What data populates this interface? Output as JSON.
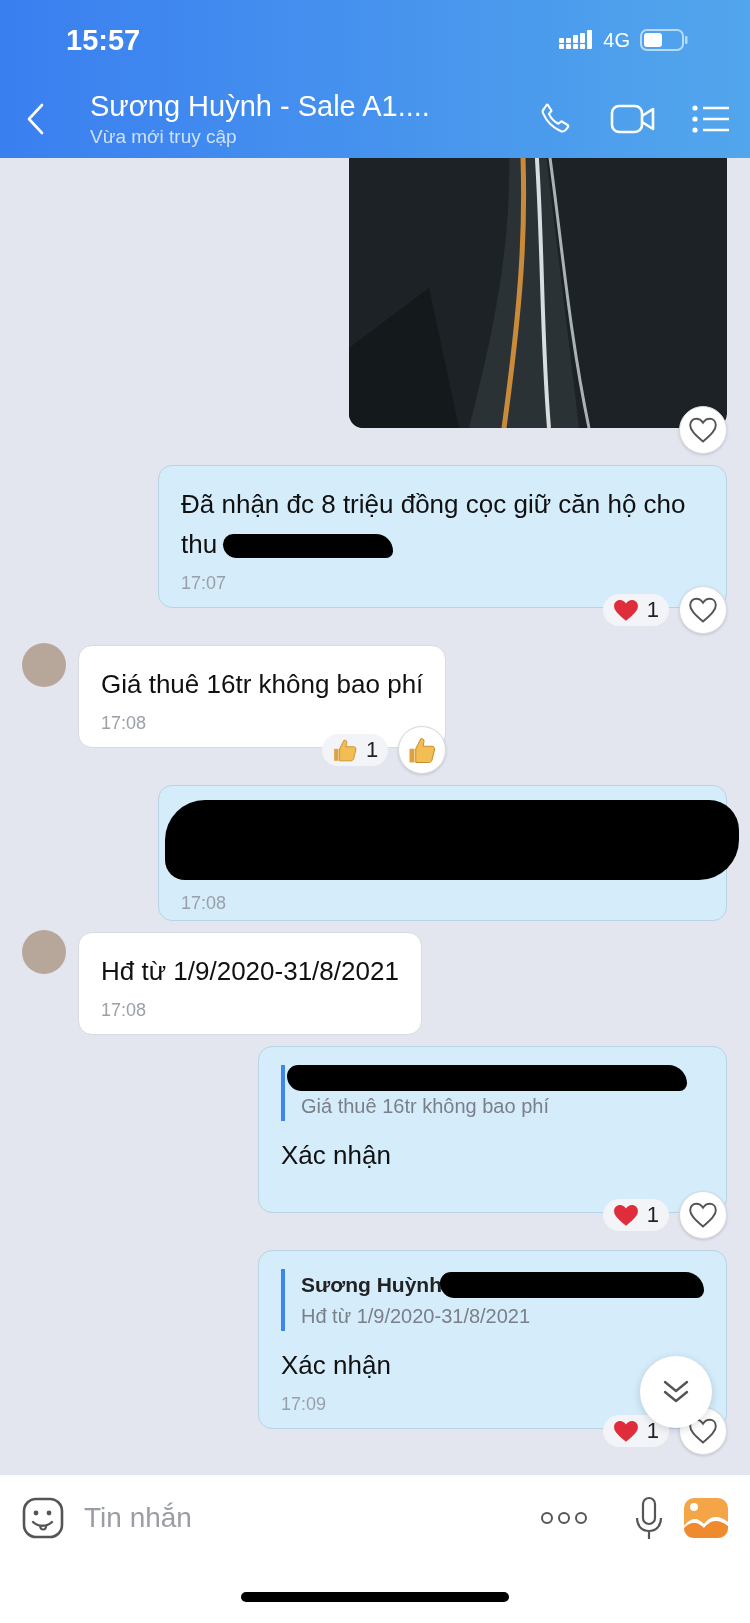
{
  "status_bar": {
    "time": "15:57",
    "network": "4G"
  },
  "header": {
    "title": "Sương Huỳnh - Sale A1....",
    "subtitle": "Vừa mới truy cập"
  },
  "messages": [
    {
      "kind": "image",
      "outgoing": true,
      "reactions": {
        "button": {
          "kind": "heart"
        }
      }
    },
    {
      "kind": "text",
      "outgoing": true,
      "text": "Đã nhận đc 8 triệu đồng cọc giữ căn hộ cho thu",
      "redacted": true,
      "time": "17:07",
      "reactions": {
        "summary": {
          "kind": "heart",
          "count": "1"
        },
        "button": {
          "kind": "heart"
        }
      }
    },
    {
      "kind": "text",
      "outgoing": false,
      "text": "Giá thuê 16tr không bao phí",
      "redacted": false,
      "time": "17:08",
      "reactions": {
        "summary": {
          "kind": "like",
          "count": "1"
        },
        "button": {
          "kind": "like"
        }
      }
    },
    {
      "kind": "redacted",
      "outgoing": true,
      "time": "17:08"
    },
    {
      "kind": "text",
      "outgoing": false,
      "text": "Hđ từ 1/9/2020-31/8/2021",
      "redacted": false,
      "time": "17:08"
    },
    {
      "kind": "reply",
      "outgoing": true,
      "quote": {
        "name_redacted": true,
        "text": "Giá thuê 16tr không bao phí"
      },
      "text": "Xác nhận",
      "reactions": {
        "summary": {
          "kind": "heart",
          "count": "1"
        },
        "button": {
          "kind": "heart"
        }
      }
    },
    {
      "kind": "reply",
      "outgoing": true,
      "quote": {
        "name": "Sương Huỳnh",
        "name_redacted": true,
        "text": "Hđ từ 1/9/2020-31/8/2021"
      },
      "text": "Xác nhận",
      "time": "17:09",
      "reactions": {
        "summary": {
          "kind": "heart",
          "count": "1"
        },
        "button": {
          "kind": "heart"
        }
      }
    }
  ],
  "composer": {
    "placeholder": "Tin nhắn"
  }
}
